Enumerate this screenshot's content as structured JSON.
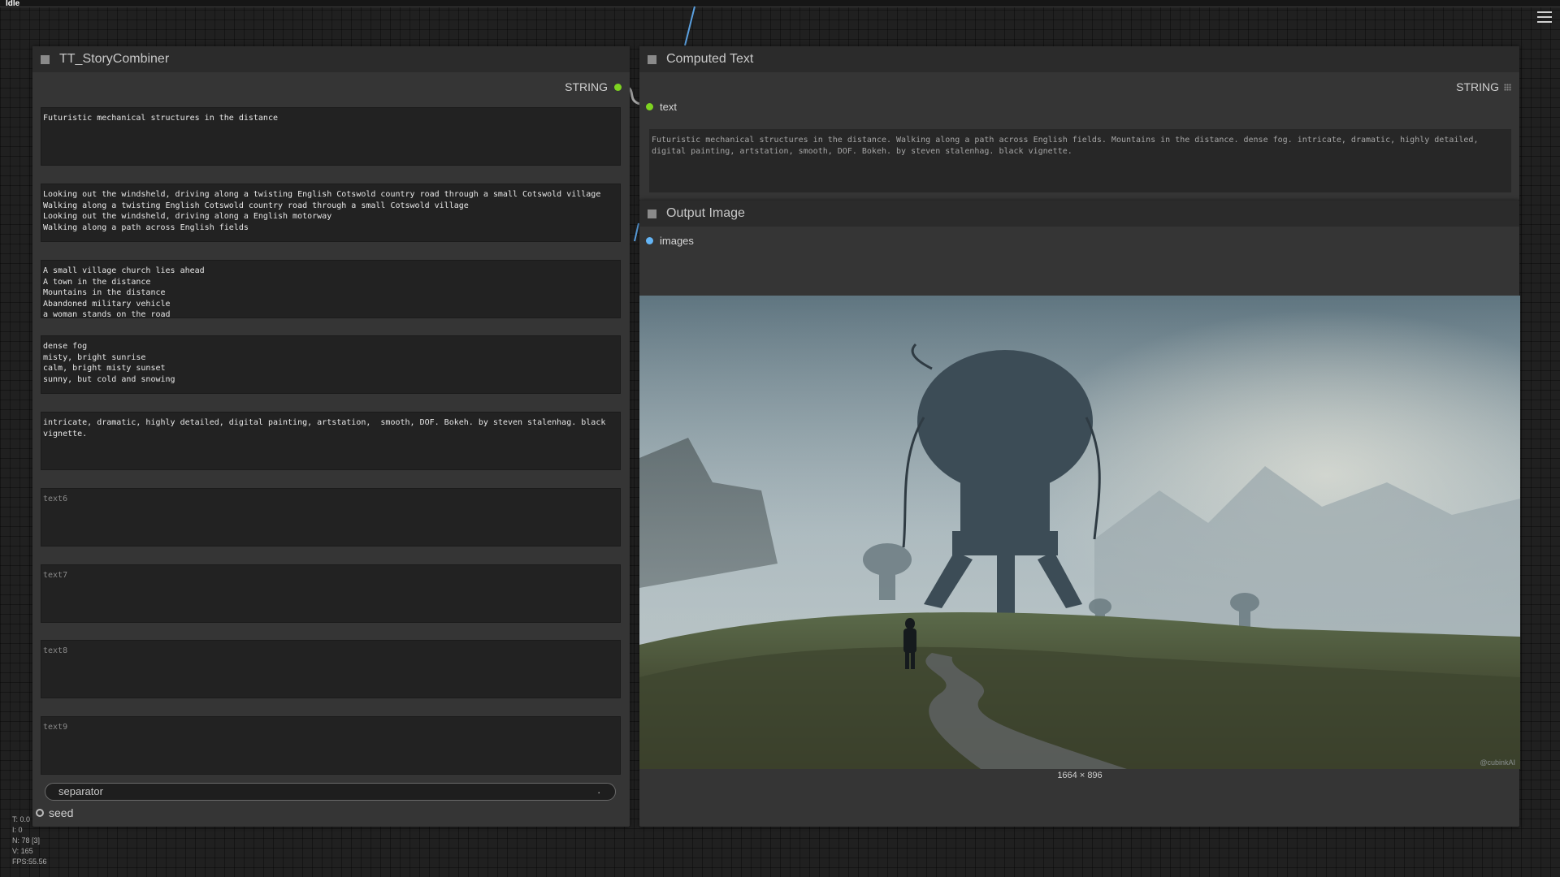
{
  "app": {
    "status": "Idle"
  },
  "story_node": {
    "title": "TT_StoryCombiner",
    "output_label": "STRING",
    "texts": [
      "Futuristic mechanical structures in the distance",
      "Looking out the windsheld, driving along a twisting English Cotswold country road through a small Cotswold village\nWalking along a twisting English Cotswold country road through a small Cotswold village\nLooking out the windsheld, driving along a English motorway\nWalking along a path across English fields",
      "A small village church lies ahead\nA town in the distance\nMountains in the distance\nAbandoned military vehicle\na woman stands on the road",
      "dense fog\nmisty, bright sunrise\ncalm, bright misty sunset\nsunny, but cold and snowing",
      "intricate, dramatic, highly detailed, digital painting, artstation,  smooth, DOF. Bokeh. by steven stalenhag. black\nvignette.",
      "",
      "",
      "",
      ""
    ],
    "placeholders": [
      "",
      "",
      "",
      "",
      "",
      "text6",
      "text7",
      "text8",
      "text9"
    ],
    "separator": {
      "label": "separator",
      "value": "."
    },
    "seed_label": "seed"
  },
  "computed_node": {
    "title": "Computed Text",
    "output_label": "STRING",
    "input_label": "text",
    "value": "Futuristic mechanical structures in the distance. Walking along a path across English fields. Mountains in the distance. dense fog. intricate, dramatic, highly detailed, digital painting, artstation,  smooth, DOF. Bokeh. by steven stalenhag. black vignette."
  },
  "output_node": {
    "title": "Output Image",
    "input_label": "images",
    "image_dims": "1664 × 896",
    "watermark": "@cubinkAI"
  },
  "stats": [
    "T: 0.0",
    "I: 0",
    "N: 78 [3]",
    "V: 165",
    "FPS:55.56"
  ],
  "colors": {
    "string_out": "#7ed321",
    "text_input": "#7ed321",
    "image_input": "#64b5f6",
    "link": "#5aa0e0"
  }
}
